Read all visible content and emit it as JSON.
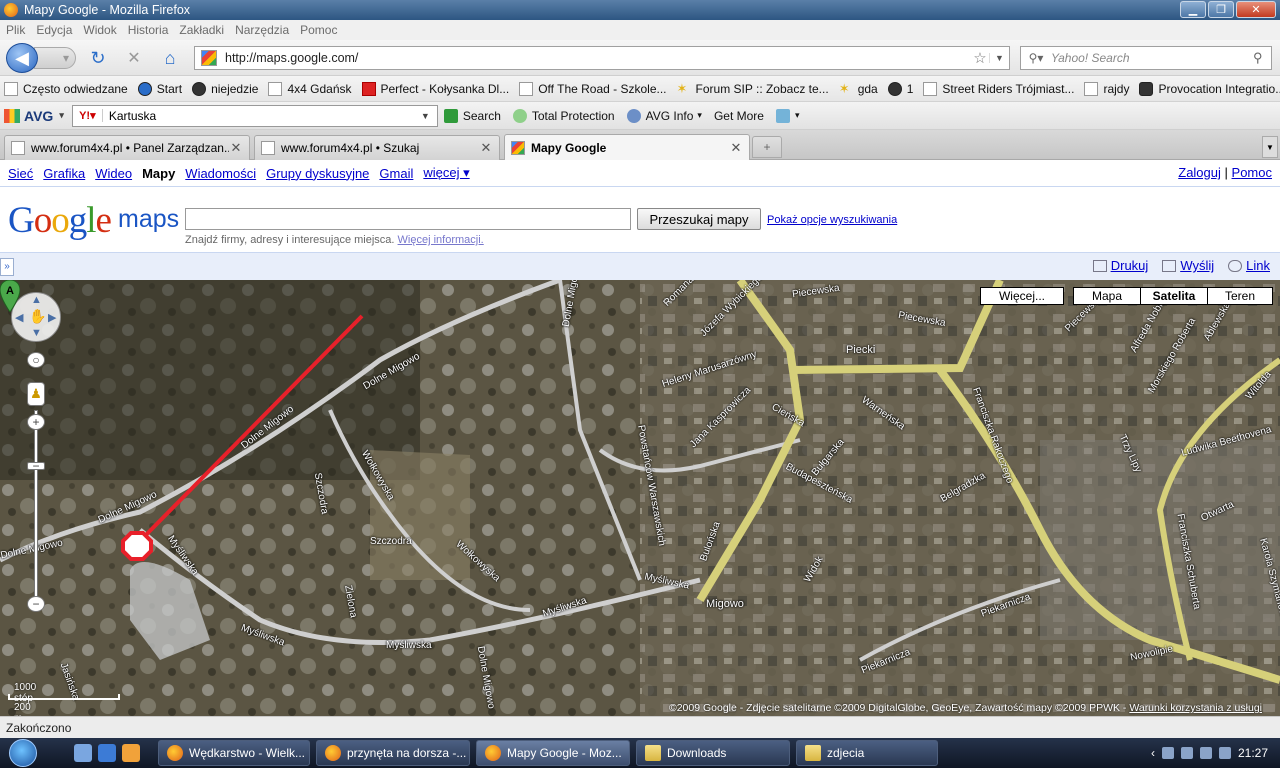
{
  "window": {
    "title": "Mapy Google - Mozilla Firefox"
  },
  "menu": [
    "Plik",
    "Edycja",
    "Widok",
    "Historia",
    "Zakładki",
    "Narzędzia",
    "Pomoc"
  ],
  "nav": {
    "url": "http://maps.google.com/",
    "search_placeholder": "Yahoo! Search"
  },
  "bookmarks": [
    {
      "label": "Często odwiedzane",
      "icon": "page-icon"
    },
    {
      "label": "Start",
      "icon": "star-icon"
    },
    {
      "label": "niejedzie",
      "icon": "circle-icon"
    },
    {
      "label": "4x4 Gdańsk",
      "icon": "page-icon"
    },
    {
      "label": "Perfect - Kołysanka Dl...",
      "icon": "youtube-icon"
    },
    {
      "label": "Off The Road - Szkole...",
      "icon": "page-icon"
    },
    {
      "label": "Forum SIP :: Zobacz te...",
      "icon": "star-icon"
    },
    {
      "label": "gda",
      "icon": "star-icon"
    },
    {
      "label": "1",
      "icon": "circle-icon"
    },
    {
      "label": "Street Riders Trójmiast...",
      "icon": "page-icon"
    },
    {
      "label": "rajdy",
      "icon": "page-icon"
    },
    {
      "label": "Provocation Integratio...",
      "icon": "mask-icon"
    }
  ],
  "avg": {
    "logo": "AVG",
    "search_value": "Kartuska",
    "search_btn": "Search",
    "protection": "Total Protection",
    "info": "AVG Info",
    "more": "Get More"
  },
  "tabs": [
    {
      "label": "www.forum4x4.pl • Panel Zarządzan...",
      "active": false
    },
    {
      "label": "www.forum4x4.pl • Szukaj",
      "active": false
    },
    {
      "label": "Mapy Google",
      "active": true
    }
  ],
  "gbar": {
    "links": [
      "Sieć",
      "Grafika",
      "Wideo"
    ],
    "current": "Mapy",
    "links2": [
      "Wiadomości",
      "Grupy dyskusyjne",
      "Gmail",
      "więcej ▾"
    ],
    "login": "Zaloguj",
    "sep": "|",
    "help": "Pomoc"
  },
  "gmaps": {
    "logo_maps": "maps",
    "search_btn": "Przeszukaj mapy",
    "options_link": "Pokaż opcje wyszukiwania",
    "hint": "Znajdź firmy, adresy i interesujące miejsca.",
    "hint_link": "Więcej informacji."
  },
  "toolbar": {
    "print": "Drukuj",
    "send": "Wyślij",
    "link": "Link",
    "collapse": "»"
  },
  "map": {
    "types": [
      "Więcej...",
      "Mapa",
      "Satelita",
      "Teren"
    ],
    "selected_type": "Satelita",
    "marker": "A",
    "scale_ft": "1000 stóp",
    "scale_m": "200 m",
    "attribution": "©2009 Google - Zdjęcie satelitarne ©2009 DigitalGlobe, GeoEye, Zawartość mapy ©2009 PPWK - ",
    "terms": "Warunki korzystania z usługi",
    "streets": [
      {
        "name": "Dolne Migowo"
      },
      {
        "name": "Dolne Migowo"
      },
      {
        "name": "Dolne Migowo"
      },
      {
        "name": "Dolne Migowo"
      },
      {
        "name": "Dolne Migowo"
      },
      {
        "name": "Myśliwska"
      },
      {
        "name": "Myśliwska"
      },
      {
        "name": "Myśliwska"
      },
      {
        "name": "Myśliwska"
      },
      {
        "name": "Myśliwska"
      },
      {
        "name": "Wołkowyska"
      },
      {
        "name": "Wołkowyska"
      },
      {
        "name": "Szczodra"
      },
      {
        "name": "Szczodra"
      },
      {
        "name": "Zielona"
      },
      {
        "name": "Powstańców Warszawskich"
      },
      {
        "name": "Piecewska"
      },
      {
        "name": "Piecewska"
      },
      {
        "name": "Piecki"
      },
      {
        "name": "Warneńska"
      },
      {
        "name": "Franciszka Rakoczego"
      },
      {
        "name": "Bułgarska"
      },
      {
        "name": "Budapeszteńska"
      },
      {
        "name": "Belgradzka"
      },
      {
        "name": "Bulońska"
      },
      {
        "name": "Migowo"
      },
      {
        "name": "Widok"
      },
      {
        "name": "Piekarnicza"
      },
      {
        "name": "Piekarnicza"
      },
      {
        "name": "Nowolipie"
      },
      {
        "name": "Franciszka Schuberta"
      },
      {
        "name": "Ludwika Beethovena"
      },
      {
        "name": "Otwarta"
      },
      {
        "name": "Karola Szymanowskiego"
      },
      {
        "name": "Jana Kasprowicza"
      },
      {
        "name": "Heleny Marusarzówny"
      },
      {
        "name": "Romana"
      },
      {
        "name": "Józefa Wybickiego"
      },
      {
        "name": "Cieńska"
      },
      {
        "name": "Trzy Lipy"
      },
      {
        "name": "Witolda"
      },
      {
        "name": "Piecewska"
      },
      {
        "name": "Alfreda Nobla"
      },
      {
        "name": "Morskiego Roberta"
      },
      {
        "name": "Ablewska"
      },
      {
        "name": "Jasińska"
      },
      {
        "name": "Dolne Migowo"
      }
    ]
  },
  "status": "Zakończono",
  "taskbar": {
    "tasks": [
      "Wędkarstwo - Wielk...",
      "przynęta na dorsza -...",
      "Mapy Google - Moz...",
      "Downloads",
      "zdjecia"
    ],
    "time": "21:27"
  }
}
